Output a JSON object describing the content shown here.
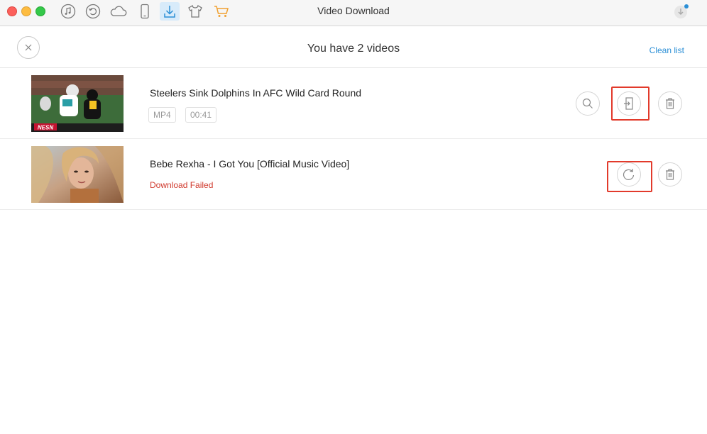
{
  "window": {
    "title": "Video Download"
  },
  "toolbar": {
    "icons": [
      "music-icon",
      "restore-icon",
      "cloud-icon",
      "phone-icon",
      "download-icon",
      "tshirt-icon",
      "cart-icon"
    ],
    "active": "download-icon",
    "colors": {
      "active_bg": "#d8ebfa",
      "active_icon": "#2b8fd6",
      "cart": "#f0a030"
    }
  },
  "header": {
    "title": "You have 2 videos",
    "clean_label": "Clean list"
  },
  "videos": [
    {
      "title": "Steelers Sink Dolphins In AFC Wild Card Round",
      "thumbnail_label": "NESN",
      "format": "MP4",
      "duration": "00:41",
      "status": "",
      "actions": [
        "search-icon",
        "import-icon",
        "trash-icon"
      ]
    },
    {
      "title": "Bebe Rexha - I Got You [Official Music Video]",
      "format": "",
      "duration": "",
      "status": "Download Failed",
      "actions": [
        "retry-icon",
        "trash-icon"
      ]
    }
  ],
  "colors": {
    "link": "#2b8fd6",
    "error": "#d0392d",
    "highlight": "#e23a2b"
  }
}
